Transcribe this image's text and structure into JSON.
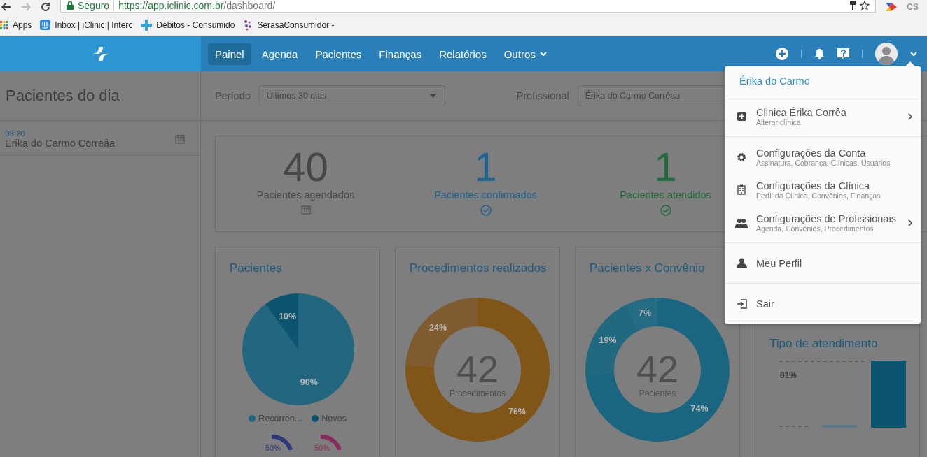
{
  "browser": {
    "security_label": "Seguro",
    "url_host": "https://app.iclinic.com.br",
    "url_path": "/dashboard/",
    "extension_text": "CS",
    "bookmarks": [
      "Apps",
      "Inbox | iClinic | Interc",
      "Débitos - Consumido",
      "SerasaConsumidor -"
    ]
  },
  "navbar": {
    "items": [
      {
        "label": "Painel",
        "selected": true
      },
      {
        "label": "Agenda",
        "selected": false
      },
      {
        "label": "Pacientes",
        "selected": false
      },
      {
        "label": "Finanças",
        "selected": false
      },
      {
        "label": "Relatórios",
        "selected": false
      },
      {
        "label": "Outros",
        "selected": false
      }
    ]
  },
  "sidebar": {
    "title": "Pacientes do dia",
    "appointments": [
      {
        "time": "09:20",
        "name": "Erika do Carmo Correâa"
      }
    ]
  },
  "filters": [
    {
      "label": "Período",
      "value": "Últimos 30 dias"
    },
    {
      "label": "Profissional",
      "value": "Érika do Carmo Corrêaa"
    }
  ],
  "stats": [
    {
      "kind": "scheduled",
      "value": "40",
      "label": "Pacientes agendados"
    },
    {
      "kind": "confirmed",
      "value": "1",
      "label": "Pacientes confirmados"
    },
    {
      "kind": "attended",
      "value": "1",
      "label": "Pacientes atendidos"
    }
  ],
  "cards": [
    {
      "title": "Pacientes",
      "chart_data": {
        "type": "pie",
        "categories": [
          "Recorren...",
          "Novos"
        ],
        "series": [
          {
            "values": [
              90,
              10
            ]
          }
        ],
        "value_labels": [
          "90%",
          "10%"
        ]
      },
      "gauges": [
        {
          "label": "50%",
          "color": "#2b3a7c"
        },
        {
          "label": "50%",
          "color": "#8a2a5c"
        }
      ]
    },
    {
      "title": "Procedimentos realizados",
      "chart_data": {
        "type": "donut",
        "series": [
          {
            "values": [
              76,
              24
            ]
          }
        ],
        "value_labels": [
          "76%",
          "24%"
        ]
      },
      "center_value": "42",
      "center_label": "Procedimentos"
    },
    {
      "title": "Pacientes x Convênio",
      "chart_data": {
        "type": "donut",
        "series": [
          {
            "values": [
              74,
              19,
              7
            ]
          }
        ],
        "value_labels": [
          "74%",
          "19%",
          "7%"
        ]
      },
      "center_value": "42",
      "center_label": "Pacientes"
    }
  ],
  "tipo_atendimento": {
    "title": "Tipo de atendimento",
    "bar_label": "81%"
  },
  "user_menu": {
    "name": "Érika do Carmo",
    "sections": [
      {
        "items": [
          {
            "title": "Clinica Érika Corrêa",
            "subtitle": "Alterar clínica",
            "submenu": true
          }
        ]
      },
      {
        "items": [
          {
            "title": "Configurações da Conta",
            "subtitle": "Assinatura, Cobrança, Clínicas, Usuários",
            "submenu": false
          },
          {
            "title": "Configurações da Clínica",
            "subtitle": "Perfil da Clínica, Convênios, Finanças",
            "submenu": false
          },
          {
            "title": "Configurações de Profissionais",
            "subtitle": "Agenda, Convênios, Procedimentos",
            "submenu": true
          }
        ]
      },
      {
        "items": [
          {
            "title": "Meu Perfil",
            "submenu": false
          }
        ]
      },
      {
        "items": [
          {
            "title": "Sair",
            "submenu": false
          }
        ]
      }
    ]
  }
}
